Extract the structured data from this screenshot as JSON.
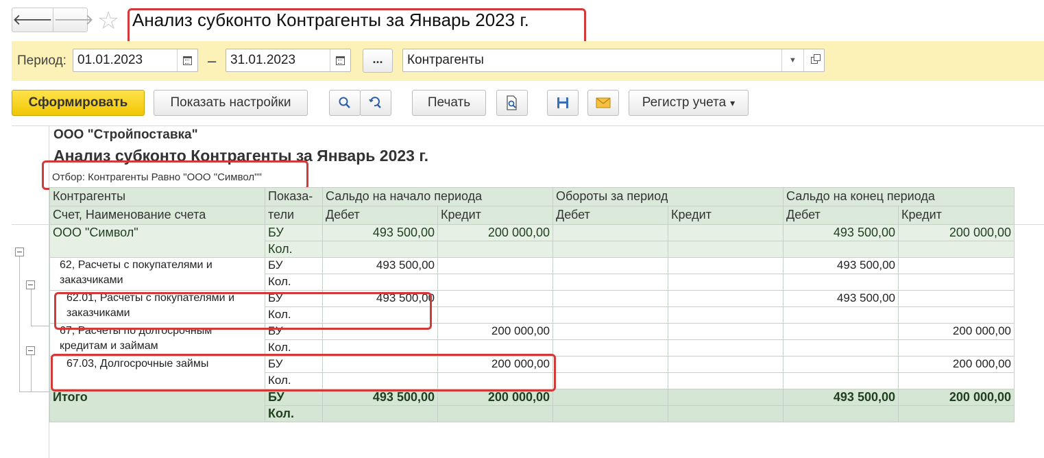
{
  "window": {
    "title": "Анализ субконто Контрагенты за Январь 2023 г.",
    "back_glyph": "🡐",
    "forward_glyph": "🡒",
    "star_glyph": "☆"
  },
  "period": {
    "label": "Период:",
    "from": "01.01.2023",
    "separator": "–",
    "to": "31.01.2023",
    "more_label": "...",
    "subconto": "Контрагенты",
    "dropdown_glyph": "▼"
  },
  "toolbar": {
    "generate": "Сформировать",
    "show_settings": "Показать настройки",
    "print": "Печать",
    "register": "Регистр учета",
    "register_arrow": "▾"
  },
  "report": {
    "org": "ООО \"Стройпоставка\"",
    "title": "Анализ субконто Контрагенты за Январь 2023 г.",
    "filter": "Отбор: Контрагенты Равно \"ООО \"Символ\"\"",
    "headers": {
      "counterparty": "Контрагенты",
      "account": "Счет, Наименование счета",
      "indicator_1": "Показа-",
      "indicator_2": "тели",
      "opening": "Сальдо на начало периода",
      "turnover": "Обороты за период",
      "closing": "Сальдо на конец периода",
      "debit": "Дебет",
      "credit": "Кредит"
    },
    "rows": [
      {
        "name": "ООО \"Символ\"",
        "ind": "БУ",
        "ind2": "Кол.",
        "od": "493 500,00",
        "oc": "200 000,00",
        "td": "",
        "tc": "",
        "cd": "493 500,00",
        "cc": "200 000,00"
      },
      {
        "name": "62, Расчеты с покупателями и заказчиками",
        "ind": "БУ",
        "ind2": "Кол.",
        "od": "493 500,00",
        "oc": "",
        "td": "",
        "tc": "",
        "cd": "493 500,00",
        "cc": ""
      },
      {
        "name": "62.01, Расчеты с покупателями и заказчиками",
        "ind": "БУ",
        "ind2": "Кол.",
        "od": "493 500,00",
        "oc": "",
        "td": "",
        "tc": "",
        "cd": "493 500,00",
        "cc": ""
      },
      {
        "name": "67, Расчеты по долгосрочным кредитам и займам",
        "ind": "БУ",
        "ind2": "Кол.",
        "od": "",
        "oc": "200 000,00",
        "td": "",
        "tc": "",
        "cd": "",
        "cc": "200 000,00"
      },
      {
        "name": "67.03, Долгосрочные займы",
        "ind": "БУ",
        "ind2": "Кол.",
        "od": "",
        "oc": "200 000,00",
        "td": "",
        "tc": "",
        "cd": "",
        "cc": "200 000,00"
      }
    ],
    "total": {
      "name": "Итого",
      "ind": "БУ",
      "ind2": "Кол.",
      "od": "493 500,00",
      "oc": "200 000,00",
      "td": "",
      "tc": "",
      "cd": "493 500,00",
      "cc": "200 000,00"
    }
  },
  "colors": {
    "highlight": "#d23a3a",
    "period_bar": "#fcf1b7",
    "primary_button": "#f1c600",
    "header_bg": "#dbe9da"
  }
}
